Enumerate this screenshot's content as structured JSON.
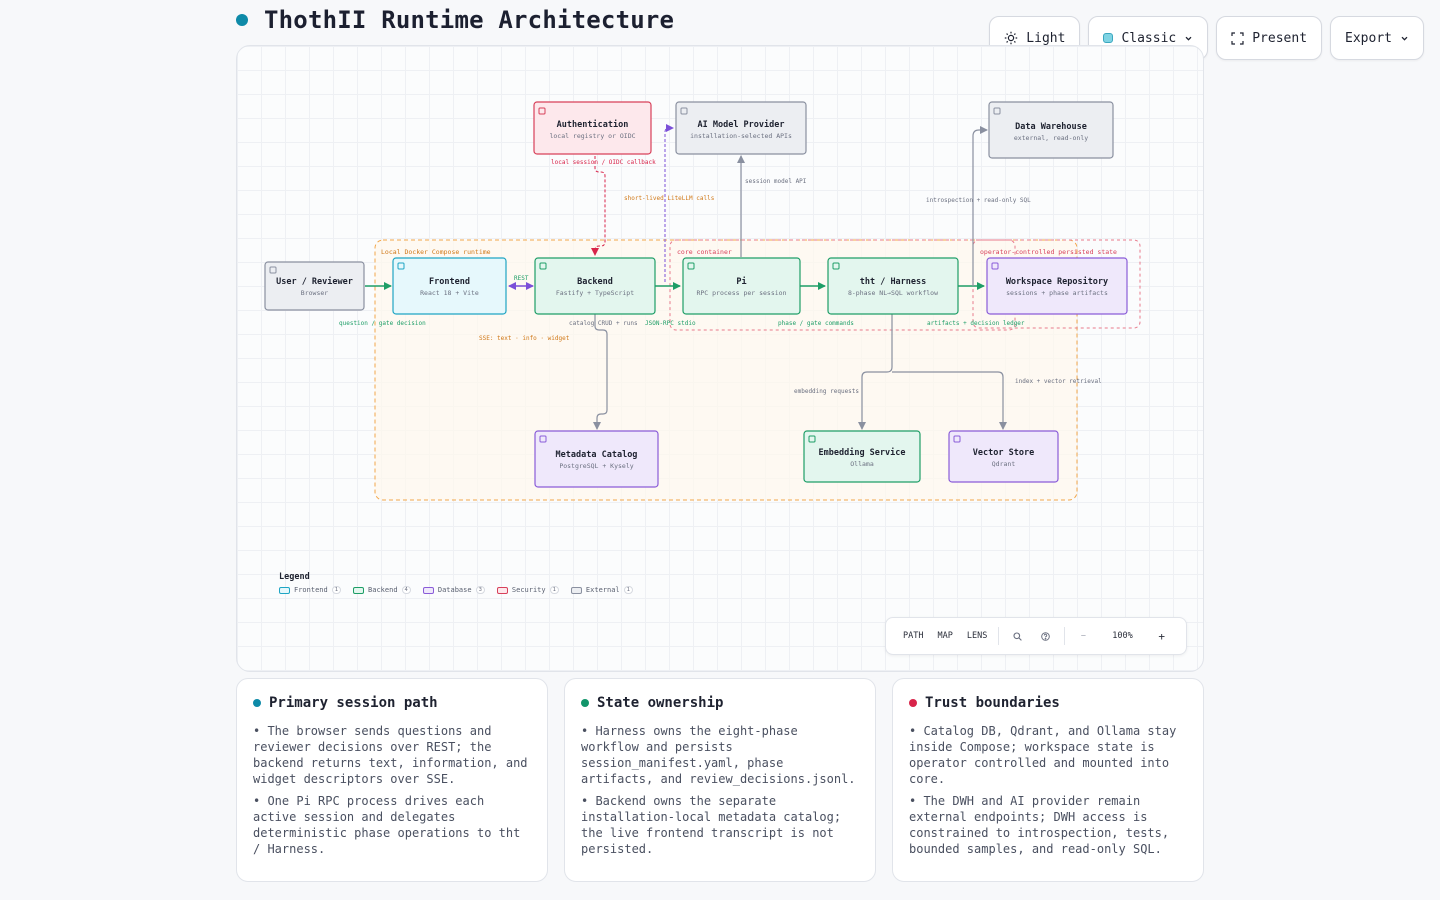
{
  "header": {
    "title": "ThothII Runtime Architecture",
    "dot_color": "#0e8aa8"
  },
  "toolbar": {
    "light_label": "Light",
    "theme_label": "Classic",
    "present_label": "Present",
    "export_label": "Export"
  },
  "diagram": {
    "groups": {
      "compose": "Local Docker Compose runtime",
      "core": "core container",
      "persisted": "operator-controlled persisted state"
    },
    "nodes": {
      "auth": {
        "title": "Authentication",
        "sub": "local registry or OIDC",
        "kind": "security"
      },
      "ai": {
        "title": "AI Model Provider",
        "sub": "installation-selected APIs",
        "kind": "external"
      },
      "dwh": {
        "title": "Data Warehouse",
        "sub": "external, read-only",
        "kind": "external"
      },
      "user": {
        "title": "User / Reviewer",
        "sub": "Browser",
        "kind": "external"
      },
      "frontend": {
        "title": "Frontend",
        "sub": "React 18 + Vite",
        "kind": "frontend"
      },
      "backend": {
        "title": "Backend",
        "sub": "Fastify + TypeScript",
        "kind": "backend"
      },
      "pi": {
        "title": "Pi",
        "sub": "RPC process per session",
        "kind": "backend"
      },
      "tht": {
        "title": "tht / Harness",
        "sub": "8-phase NL→SQL workflow",
        "kind": "backend"
      },
      "workspace": {
        "title": "Workspace Repository",
        "sub": "sessions + phase artifacts",
        "kind": "database"
      },
      "catalog": {
        "title": "Metadata Catalog",
        "sub": "PostgreSQL + Kysely",
        "kind": "database"
      },
      "embedding": {
        "title": "Embedding Service",
        "sub": "Ollama",
        "kind": "backend"
      },
      "vector": {
        "title": "Vector Store",
        "sub": "Qdrant",
        "kind": "database"
      }
    },
    "edges": {
      "auth_backend": "local session / OIDC callback",
      "backend_ai": "short-lived LiteLLM calls",
      "pi_ai": "session model API",
      "tht_dwh": "introspection + read-only SQL",
      "frontend_backend": "REST",
      "user_frontend": "question / gate decision",
      "backend_catalog": "catalog CRUD + runs",
      "backend_pi": "JSON-RPC stdio",
      "pi_tht": "phase / gate commands",
      "tht_workspace": "artifacts + decision ledger",
      "sse": "SSE: text · info · widget",
      "tht_embedding": "embedding requests",
      "tht_vector": "index + vector retrieval"
    }
  },
  "legend": {
    "title": "Legend",
    "items": [
      {
        "label": "Frontend",
        "count": "1",
        "fill": "#e6f8fc",
        "stroke": "#1fa5c4"
      },
      {
        "label": "Backend",
        "count": "4",
        "fill": "#e3f6ee",
        "stroke": "#1e9e67"
      },
      {
        "label": "Database",
        "count": "3",
        "fill": "#efe8fb",
        "stroke": "#8a5cd8"
      },
      {
        "label": "Security",
        "count": "1",
        "fill": "#fde8ec",
        "stroke": "#d8405a"
      },
      {
        "label": "External",
        "count": "1",
        "fill": "#eceef2",
        "stroke": "#8a90a0"
      }
    ]
  },
  "controls": {
    "path": "PATH",
    "map": "MAP",
    "lens": "LENS",
    "zoom": "100%",
    "minus": "−",
    "plus": "+"
  },
  "cards": [
    {
      "title": "Primary session path",
      "dot": "#0e8aa8",
      "bullets": [
        "• The browser sends questions and reviewer decisions over REST; the backend returns text, information, and widget descriptors over SSE.",
        "• One Pi RPC process drives each active session and delegates deterministic phase operations to tht / Harness."
      ]
    },
    {
      "title": "State ownership",
      "dot": "#12956a",
      "bullets": [
        "• Harness owns the eight-phase workflow and persists session_manifest.yaml, phase artifacts, and review_decisions.jsonl.",
        "• Backend owns the separate installation-local metadata catalog; the live frontend transcript is not persisted."
      ]
    },
    {
      "title": "Trust boundaries",
      "dot": "#d8244a",
      "bullets": [
        "• Catalog DB, Qdrant, and Ollama stay inside Compose; workspace state is operator controlled and mounted into core.",
        "• The DWH and AI provider remain external endpoints; DWH access is constrained to introspection, tests, bounded samples, and read-only SQL."
      ]
    }
  ]
}
